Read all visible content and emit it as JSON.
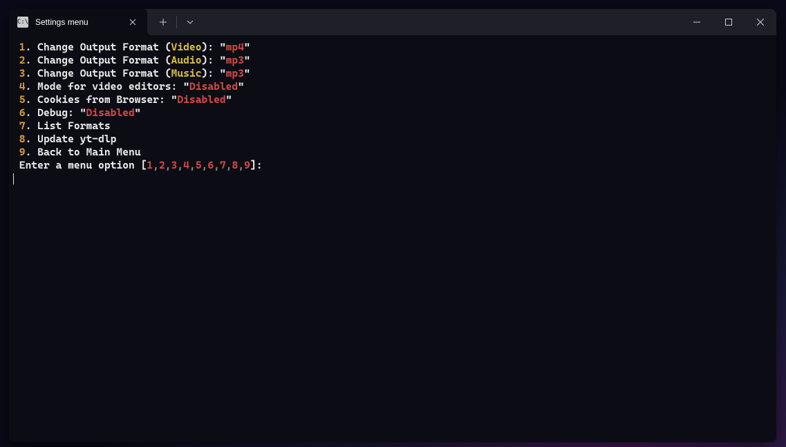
{
  "tab": {
    "title": "Settings menu"
  },
  "menu": {
    "items": [
      {
        "num": "1",
        "prefix": ". Change Output Format (",
        "tag": "Video",
        "mid": "): \"",
        "val": "mp4",
        "suffix": "\""
      },
      {
        "num": "2",
        "prefix": ". Change Output Format (",
        "tag": "Audio",
        "mid": "): \"",
        "val": "mp3",
        "suffix": "\""
      },
      {
        "num": "3",
        "prefix": ". Change Output Format (",
        "tag": "Music",
        "mid": "): \"",
        "val": "mp3",
        "suffix": "\""
      },
      {
        "num": "4",
        "prefix": ". Mode for video editors: \"",
        "val": "Disabled",
        "suffix": "\""
      },
      {
        "num": "5",
        "prefix": ". Cookies from Browser: \"",
        "val": "Disabled",
        "suffix": "\""
      },
      {
        "num": "6",
        "prefix": ". Debug: \"",
        "val": "Disabled",
        "suffix": "\""
      },
      {
        "num": "7",
        "prefix": ". List Formats"
      },
      {
        "num": "8",
        "prefix": ". Update yt-dlp"
      },
      {
        "num": "9",
        "prefix": ". Back to Main Menu"
      }
    ],
    "prompt_prefix": " Enter a menu option [",
    "prompt_options": [
      "1",
      "2",
      "3",
      "4",
      "5",
      "6",
      "7",
      "8",
      "9"
    ],
    "prompt_suffix": "]:"
  }
}
